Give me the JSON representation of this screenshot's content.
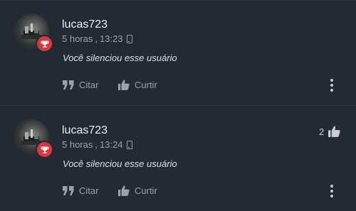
{
  "posts": [
    {
      "username": "lucas723",
      "relative_time": "5 horas",
      "clock_time": "13:23",
      "device_icon": "phone-icon",
      "message": "Você silenciou esse usuário",
      "actions": {
        "quote_label": "Citar",
        "like_label": "Curtir"
      },
      "like_count": null
    },
    {
      "username": "lucas723",
      "relative_time": "5 horas",
      "clock_time": "13:24",
      "device_icon": "phone-icon",
      "message": "Você silenciou esse usuário",
      "actions": {
        "quote_label": "Citar",
        "like_label": "Curtir"
      },
      "like_count": "2"
    }
  ],
  "colors": {
    "background": "#232a34",
    "badge": "#d8383e",
    "muted_text": "#9aa2ab"
  }
}
